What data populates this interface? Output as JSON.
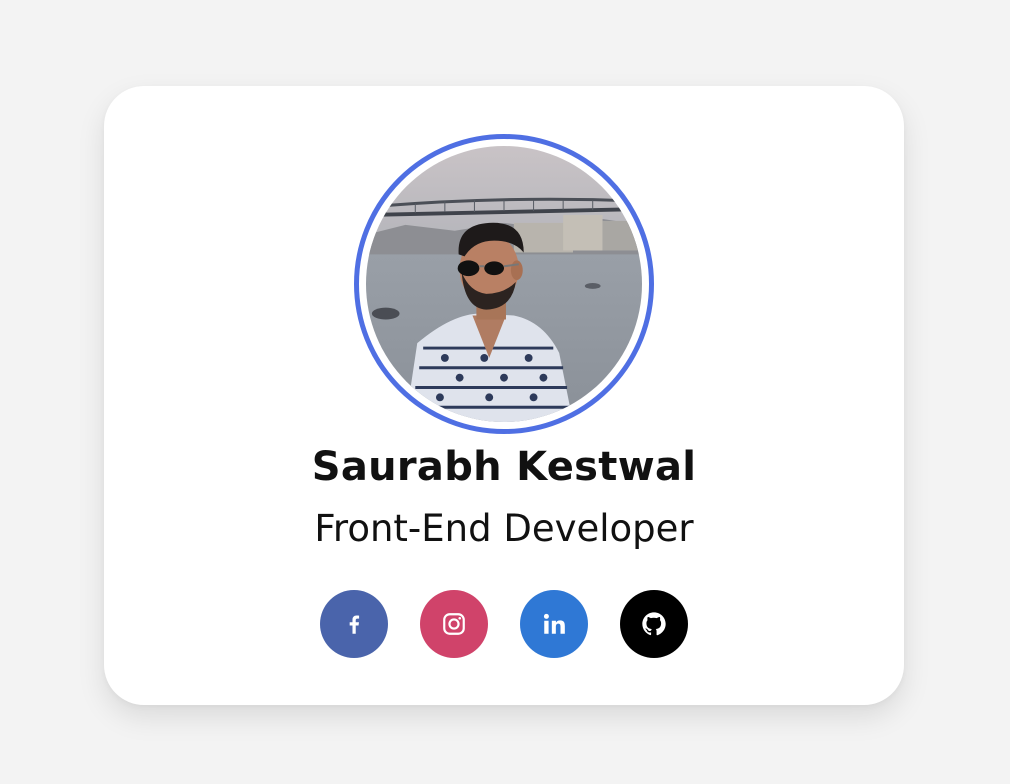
{
  "profile": {
    "name": "Saurabh Kestwal",
    "role": "Front-End Developer",
    "ring_color": "#4f6fe3"
  },
  "socials": [
    {
      "network": "facebook",
      "icon": "facebook-icon",
      "color": "#4a64ab"
    },
    {
      "network": "instagram",
      "icon": "instagram-icon",
      "color": "#d0436a"
    },
    {
      "network": "linkedin",
      "icon": "linkedin-icon",
      "color": "#2f78d5"
    },
    {
      "network": "github",
      "icon": "github-icon",
      "color": "#000000"
    }
  ]
}
